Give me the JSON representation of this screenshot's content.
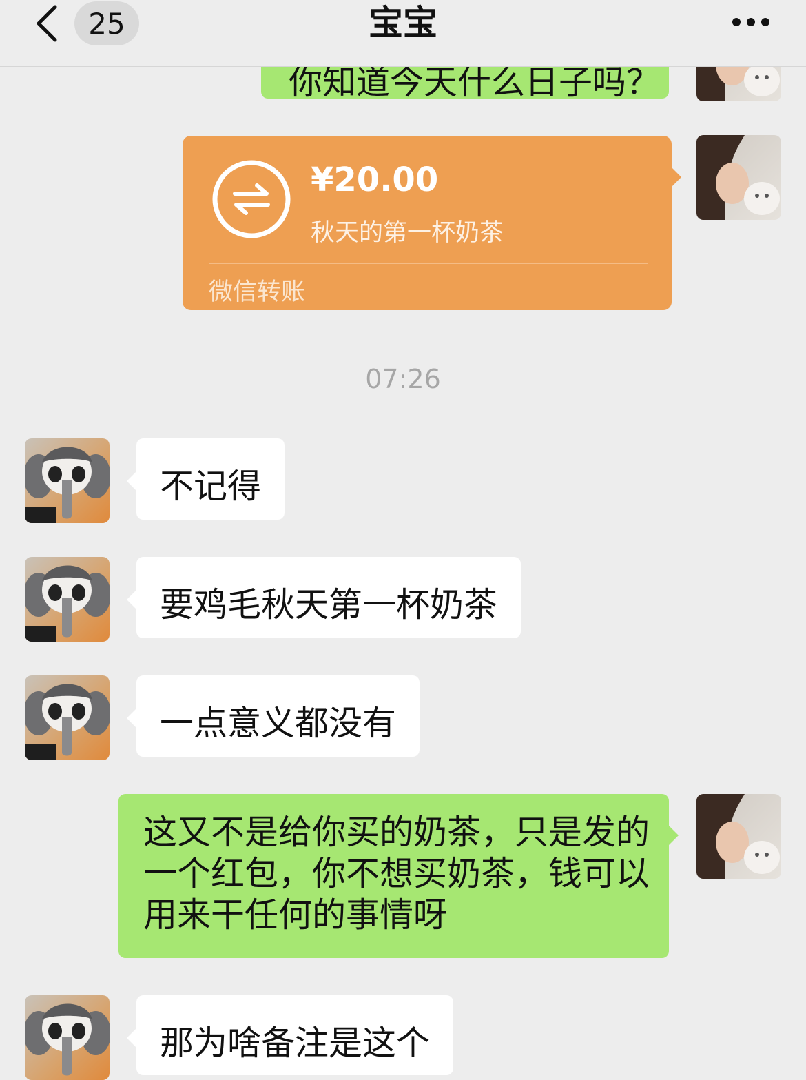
{
  "header": {
    "unread_count": "25",
    "title": "宝宝"
  },
  "messages": {
    "top_partial_text": "你知道今天什么日子吗？",
    "transfer": {
      "amount": "¥20.00",
      "note": "秋天的第一杯奶茶",
      "label": "微信转账"
    },
    "timestamp": "07:26",
    "in_1": "不记得",
    "in_2": "要鸡毛秋天第一杯奶茶",
    "in_3": "一点意义都没有",
    "out_long": [
      "这又不是给你买的奶茶，只是发的",
      "一个红包，你不想买奶茶，钱可以",
      "用来干任何的事情呀"
    ],
    "in_4": "那为啥备注是这个"
  },
  "colors": {
    "background": "#ededed",
    "bubble_out": "#a6e772",
    "bubble_in": "#ffffff",
    "transfer": "#ee9f52",
    "timestamp": "#a6a6a6"
  },
  "icons": {
    "back": "chevron-left-icon",
    "more": "more-dots-icon",
    "transfer": "transfer-arrows-icon"
  }
}
